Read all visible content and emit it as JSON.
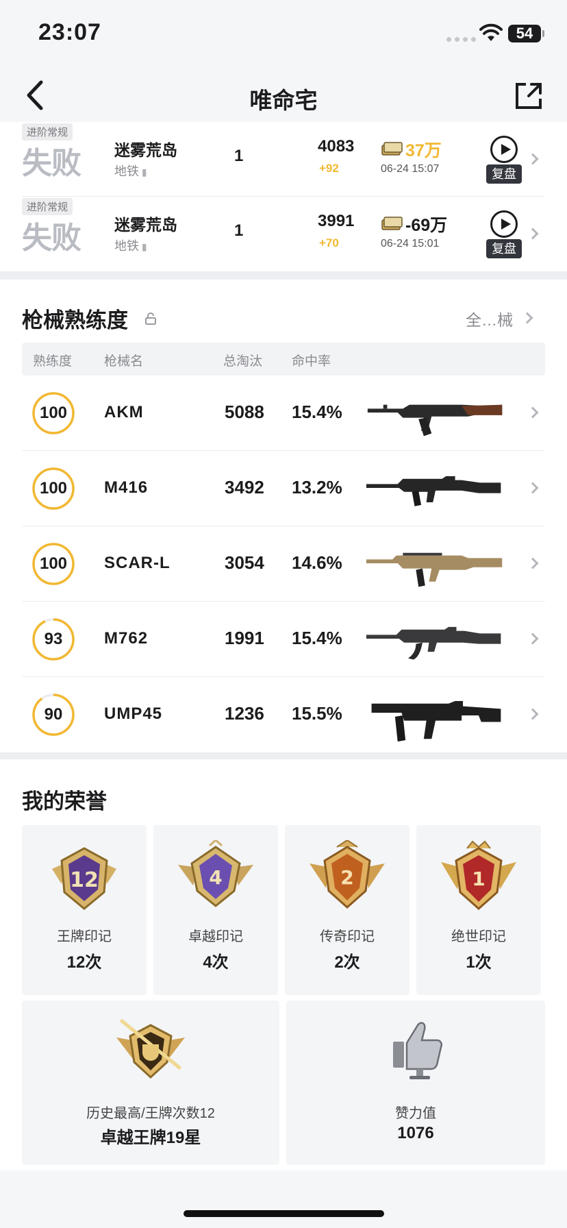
{
  "status_bar": {
    "time": "23:07",
    "battery": "54"
  },
  "nav": {
    "title": "唯命宅"
  },
  "matches": [
    {
      "mode": "进阶常规",
      "result": "失败",
      "map": "迷雾荒岛",
      "sub": "地铁",
      "rank": "1",
      "score": "4083",
      "delta": "+92",
      "money": "37万",
      "money_positive": true,
      "date": "06-24 15:07",
      "replay": "复盘"
    },
    {
      "mode": "进阶常规",
      "result": "失败",
      "map": "迷雾荒岛",
      "sub": "地铁",
      "rank": "1",
      "score": "3991",
      "delta": "+70",
      "money": "-69万",
      "money_positive": false,
      "date": "06-24 15:01",
      "replay": "复盘"
    }
  ],
  "weapons_section": {
    "title": "枪械熟练度",
    "all_link": "全…械",
    "headers": {
      "proficiency": "熟练度",
      "name": "枪械名",
      "kills": "总淘汰",
      "accuracy": "命中率"
    },
    "rows": [
      {
        "proficiency": 100,
        "name": "AKM",
        "kills": "5088",
        "accuracy": "15.4%",
        "gun_icon": "akm-rifle"
      },
      {
        "proficiency": 100,
        "name": "M416",
        "kills": "3492",
        "accuracy": "13.2%",
        "gun_icon": "m416-rifle"
      },
      {
        "proficiency": 100,
        "name": "SCAR-L",
        "kills": "3054",
        "accuracy": "14.6%",
        "gun_icon": "scar-l-rifle"
      },
      {
        "proficiency": 93,
        "name": "M762",
        "kills": "1991",
        "accuracy": "15.4%",
        "gun_icon": "m762-rifle"
      },
      {
        "proficiency": 90,
        "name": "UMP45",
        "kills": "1236",
        "accuracy": "15.5%",
        "gun_icon": "ump45-smg"
      }
    ]
  },
  "honors": {
    "title": "我的荣誉",
    "cards": [
      {
        "badge_text": "12",
        "label": "王牌印记",
        "value": "12次",
        "color": "#5a3a8c"
      },
      {
        "badge_text": "4",
        "label": "卓越印记",
        "value": "4次",
        "color": "#6b4fb0"
      },
      {
        "badge_text": "2",
        "label": "传奇印记",
        "value": "2次",
        "color": "#c0601f"
      },
      {
        "badge_text": "1",
        "label": "绝世印记",
        "value": "1次",
        "color": "#b02828"
      }
    ],
    "wide_cards": [
      {
        "label": "历史最高/王牌次数12",
        "value": "卓越王牌19星",
        "icon": "trophy-badge-icon"
      },
      {
        "label": "赞力值",
        "value": "1076",
        "icon": "thumbs-up-icon"
      }
    ]
  },
  "colors": {
    "accent_gold": "#f2b832",
    "ring_track": "#ececee"
  }
}
